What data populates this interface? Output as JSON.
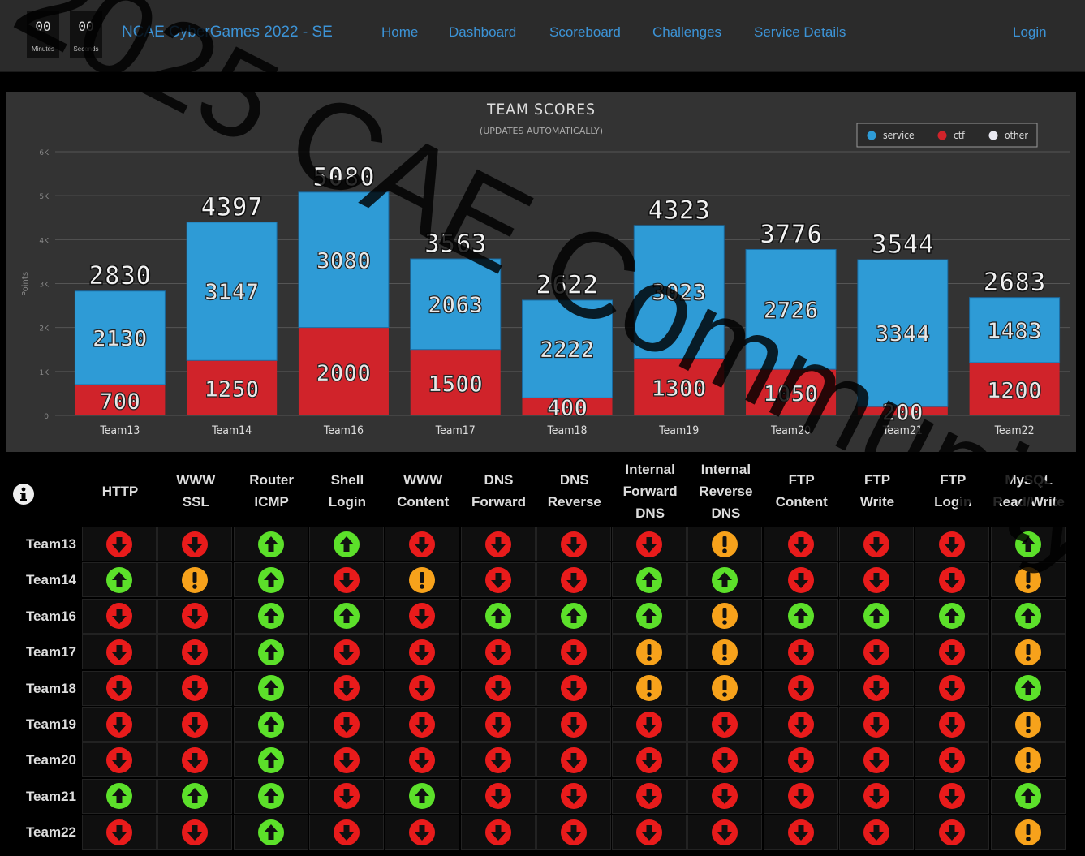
{
  "timer": {
    "minutes": "00",
    "minutes_label": "Minutes",
    "seconds": "00",
    "seconds_label": "Seconds"
  },
  "brand": "NCAE CyberGames 2022 - SE",
  "nav": [
    "Home",
    "Dashboard",
    "Scoreboard",
    "Challenges",
    "Service Details"
  ],
  "login": "Login",
  "watermark": "2025 CAE Community",
  "colors": {
    "service": "#2e9bd6",
    "ctf": "#d0232a",
    "other": "#e8e8f0",
    "up": "#5ce02a",
    "down": "#e81b1b",
    "warn": "#f7a21b"
  },
  "chart_data": {
    "type": "bar",
    "title": "TEAM SCORES",
    "subtitle": "(UPDATES AUTOMATICALLY)",
    "ylabel": "Points",
    "xlabel": "",
    "ylim": [
      0,
      6000
    ],
    "yticks": [
      "0",
      "1K",
      "2K",
      "3K",
      "4K",
      "5K",
      "6K"
    ],
    "legend_position": "top-right",
    "grid": true,
    "stacked": true,
    "categories": [
      "Team13",
      "Team14",
      "Team16",
      "Team17",
      "Team18",
      "Team19",
      "Team20",
      "Team21",
      "Team22"
    ],
    "series": [
      {
        "name": "ctf",
        "values": [
          700,
          1250,
          2000,
          1500,
          400,
          1300,
          1050,
          200,
          1200
        ]
      },
      {
        "name": "service",
        "values": [
          2130,
          3147,
          3080,
          2063,
          2222,
          3023,
          2726,
          3344,
          1483
        ]
      },
      {
        "name": "other",
        "values": [
          0,
          0,
          0,
          0,
          0,
          0,
          0,
          0,
          0
        ]
      }
    ],
    "totals": [
      2830,
      4397,
      5080,
      3563,
      2622,
      4323,
      3776,
      3544,
      2683
    ]
  },
  "services": [
    "HTTP",
    "WWW SSL",
    "Router ICMP",
    "Shell Login",
    "WWW Content",
    "DNS Forward",
    "DNS Reverse",
    "Internal Forward DNS",
    "Internal Reverse DNS",
    "FTP Content",
    "FTP Write",
    "FTP Login",
    "MySQL Read/Write"
  ],
  "rows": [
    {
      "team": "Team13",
      "status": [
        "down",
        "down",
        "up",
        "up",
        "down",
        "down",
        "down",
        "down",
        "warn",
        "down",
        "down",
        "down",
        "up"
      ]
    },
    {
      "team": "Team14",
      "status": [
        "up",
        "warn",
        "up",
        "down",
        "warn",
        "down",
        "down",
        "up",
        "up",
        "down",
        "down",
        "down",
        "warn"
      ]
    },
    {
      "team": "Team16",
      "status": [
        "down",
        "down",
        "up",
        "up",
        "down",
        "up",
        "up",
        "up",
        "warn",
        "up",
        "up",
        "up",
        "up"
      ]
    },
    {
      "team": "Team17",
      "status": [
        "down",
        "down",
        "up",
        "down",
        "down",
        "down",
        "down",
        "warn",
        "warn",
        "down",
        "down",
        "down",
        "warn"
      ]
    },
    {
      "team": "Team18",
      "status": [
        "down",
        "down",
        "up",
        "down",
        "down",
        "down",
        "down",
        "warn",
        "warn",
        "down",
        "down",
        "down",
        "up"
      ]
    },
    {
      "team": "Team19",
      "status": [
        "down",
        "down",
        "up",
        "down",
        "down",
        "down",
        "down",
        "down",
        "down",
        "down",
        "down",
        "down",
        "warn"
      ]
    },
    {
      "team": "Team20",
      "status": [
        "down",
        "down",
        "up",
        "down",
        "down",
        "down",
        "down",
        "down",
        "down",
        "down",
        "down",
        "down",
        "warn"
      ]
    },
    {
      "team": "Team21",
      "status": [
        "up",
        "up",
        "up",
        "down",
        "up",
        "down",
        "down",
        "down",
        "down",
        "down",
        "down",
        "down",
        "up"
      ]
    },
    {
      "team": "Team22",
      "status": [
        "down",
        "down",
        "up",
        "down",
        "down",
        "down",
        "down",
        "down",
        "down",
        "down",
        "down",
        "down",
        "warn"
      ]
    }
  ]
}
